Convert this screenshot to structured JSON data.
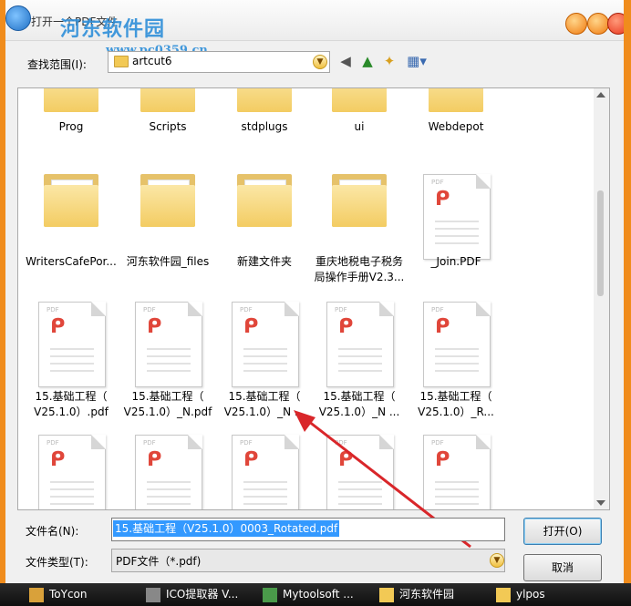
{
  "window": {
    "title": "打开一个PDF文件",
    "watermark_name": "河东软件园",
    "watermark_url": "www.pc0359.cn"
  },
  "lookin": {
    "label": "查找范围(I):",
    "value": "artcut6"
  },
  "files_row1": [
    {
      "label": "Prog",
      "type": "folder"
    },
    {
      "label": "Scripts",
      "type": "folder"
    },
    {
      "label": "stdplugs",
      "type": "folder"
    },
    {
      "label": "ui",
      "type": "folder"
    },
    {
      "label": "Webdepot",
      "type": "folder"
    }
  ],
  "files_row2": [
    {
      "label": "WritersCafePor...",
      "type": "folder"
    },
    {
      "label": "河东软件园_files",
      "type": "folder"
    },
    {
      "label": "新建文件夹",
      "type": "folder"
    },
    {
      "label": "重庆地税电子税务\n局操作手册V2.3...",
      "type": "folder"
    },
    {
      "label": "_Join.PDF",
      "type": "pdf"
    }
  ],
  "files_row3": [
    {
      "label": "15.基础工程（\nV25.1.0）.pdf",
      "type": "pdf"
    },
    {
      "label": "15.基础工程（\nV25.1.0）_N.pdf",
      "type": "pdf"
    },
    {
      "label": "15.基础工程（\nV25.1.0）_N ...",
      "type": "pdf"
    },
    {
      "label": "15.基础工程（\nV25.1.0）_N ...",
      "type": "pdf"
    },
    {
      "label": "15.基础工程（\nV25.1.0）_R...",
      "type": "pdf"
    }
  ],
  "pdf_tag": "PDF",
  "filename": {
    "label": "文件名(N):",
    "value": "15.基础工程（V25.1.0）0003_Rotated.pdf"
  },
  "filetype": {
    "label": "文件类型(T):",
    "value": "PDF文件（*.pdf)"
  },
  "buttons": {
    "open": "打开(O)",
    "cancel": "取消"
  },
  "taskbar": [
    {
      "label": "ToYcon"
    },
    {
      "label": "ICO提取器 V..."
    },
    {
      "label": "Mytoolsoft ..."
    },
    {
      "label": "河东软件园"
    },
    {
      "label": "ylpos"
    }
  ],
  "colors": {
    "accent_orange": "#f08c1c",
    "selection_blue": "#3399ff",
    "arrow_red": "#d9262a"
  }
}
